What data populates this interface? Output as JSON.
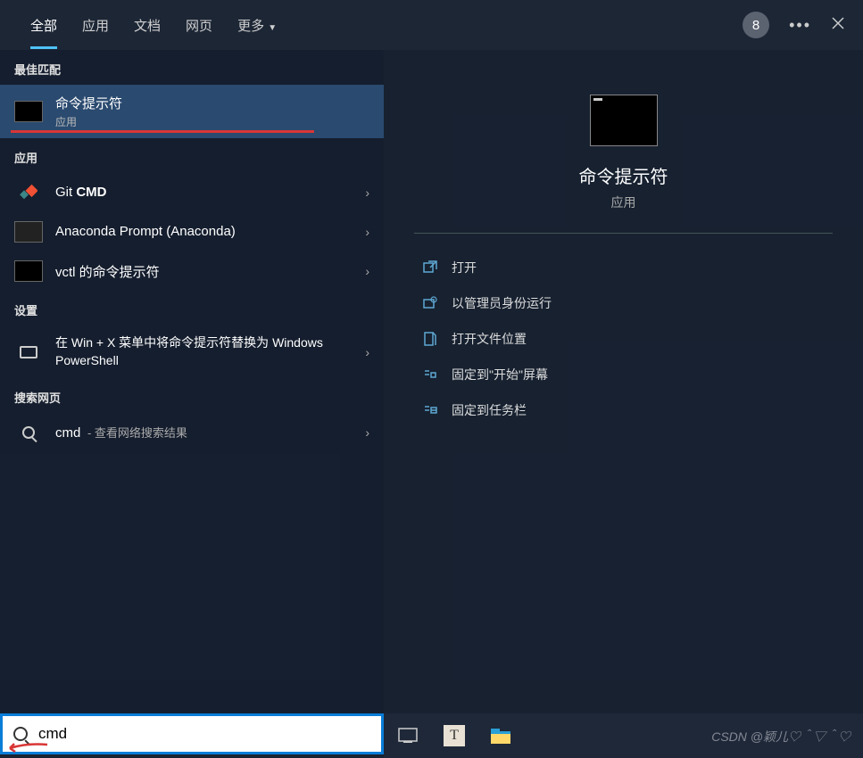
{
  "tabs": {
    "all": "全部",
    "apps": "应用",
    "docs": "文档",
    "web": "网页",
    "more": "更多",
    "badge": "8"
  },
  "left": {
    "best_match": "最佳匹配",
    "selected": {
      "title": "命令提示符",
      "sub": "应用"
    },
    "apps_hdr": "应用",
    "apps": [
      {
        "title_pre": "Git ",
        "title_bold": "CMD"
      },
      {
        "title": "Anaconda Prompt (Anaconda)"
      },
      {
        "title": "vctl 的命令提示符"
      }
    ],
    "settings_hdr": "设置",
    "setting": "在 Win + X 菜单中将命令提示符替换为 Windows PowerShell",
    "web_hdr": "搜索网页",
    "web_term": "cmd",
    "web_suffix": " - 查看网络搜索结果"
  },
  "preview": {
    "title": "命令提示符",
    "sub": "应用",
    "actions": {
      "open": "打开",
      "admin": "以管理员身份运行",
      "location": "打开文件位置",
      "pin_start": "固定到\"开始\"屏幕",
      "pin_task": "固定到任务栏"
    }
  },
  "search": {
    "query": "cmd"
  },
  "watermark": "CSDN @颖儿♡＾▽＾♡"
}
